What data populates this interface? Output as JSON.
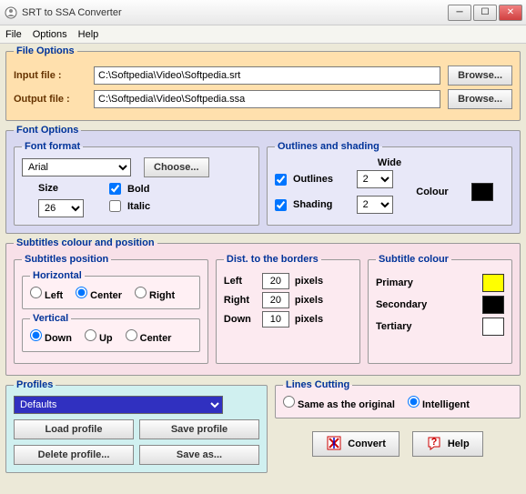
{
  "window": {
    "title": "SRT to SSA Converter"
  },
  "menu": {
    "file": "File",
    "options": "Options",
    "help": "Help"
  },
  "file_options": {
    "legend": "File Options",
    "input_label": "Input file :",
    "input_value": "C:\\Softpedia\\Video\\Softpedia.srt",
    "output_label": "Output file :",
    "output_value": "C:\\Softpedia\\Video\\Softpedia.ssa",
    "browse": "Browse..."
  },
  "font_options": {
    "legend": "Font Options",
    "format_legend": "Font format",
    "font": "Arial",
    "choose": "Choose...",
    "size_label": "Size",
    "size": "26",
    "bold": "Bold",
    "italic": "Italic",
    "outlines_legend": "Outlines and shading",
    "wide": "Wide",
    "outlines": "Outlines",
    "shading": "Shading",
    "outline_val": "2",
    "shading_val": "2",
    "colour": "Colour"
  },
  "subtitles": {
    "legend": "Subtitles colour and position",
    "pos_legend": "Subtitles position",
    "horizontal": "Horizontal",
    "vertical": "Vertical",
    "left": "Left",
    "center": "Center",
    "right": "Right",
    "down": "Down",
    "up": "Up",
    "dist_legend": "Dist. to the borders",
    "dist_left": "20",
    "dist_right": "20",
    "dist_down": "10",
    "pixels": "pixels",
    "colour_legend": "Subtitle colour",
    "primary": "Primary",
    "secondary": "Secondary",
    "tertiary": "Tertiary"
  },
  "profiles": {
    "legend": "Profiles",
    "selected": "Defaults",
    "load": "Load profile",
    "save": "Save profile",
    "delete": "Delete profile...",
    "saveas": "Save as..."
  },
  "lines": {
    "legend": "Lines Cutting",
    "same": "Same as the original",
    "intelligent": "Intelligent"
  },
  "actions": {
    "convert": "Convert",
    "help": "Help"
  }
}
